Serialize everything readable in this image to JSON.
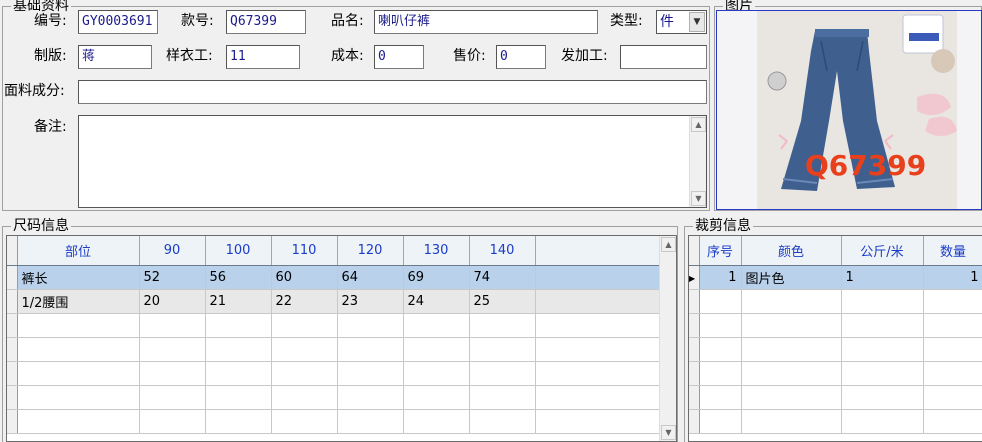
{
  "basic": {
    "title": "基础资料",
    "code_label": "编号:",
    "code_value": "GY0003691",
    "style_label": "款号:",
    "style_value": "Q67399",
    "name_label": "品名:",
    "name_value": "喇叭仔裤",
    "type_label": "类型:",
    "type_value": "件",
    "maker_label": "制版:",
    "maker_value": "蒋",
    "sample_label": "样衣工:",
    "sample_value": "11",
    "cost_label": "成本:",
    "cost_value": "0",
    "price_label": "售价:",
    "price_value": "0",
    "process_label": "发加工:",
    "process_value": "",
    "fabric_label": "面料成分:",
    "fabric_value": "",
    "note_label": "备注:",
    "note_value": ""
  },
  "picture": {
    "title": "图片",
    "overlay_text": "Q67399"
  },
  "size_info": {
    "title": "尺码信息",
    "columns": [
      "部位",
      "90",
      "100",
      "110",
      "120",
      "130",
      "140"
    ],
    "rows": [
      [
        "裤长",
        "52",
        "56",
        "60",
        "64",
        "69",
        "74"
      ],
      [
        "1/2腰围",
        "20",
        "21",
        "22",
        "23",
        "24",
        "25"
      ]
    ]
  },
  "cut_info": {
    "title": "裁剪信息",
    "columns": [
      "序号",
      "颜色",
      "公斤/米",
      "数量"
    ],
    "rows": [
      [
        "1",
        "图片色",
        "1",
        "1"
      ]
    ]
  },
  "colors": {
    "header_text": "#1a3cc8",
    "selected_row": "#b9d1ea",
    "field_text": "#1a1a8c",
    "overlay_text": "#e8401c"
  }
}
